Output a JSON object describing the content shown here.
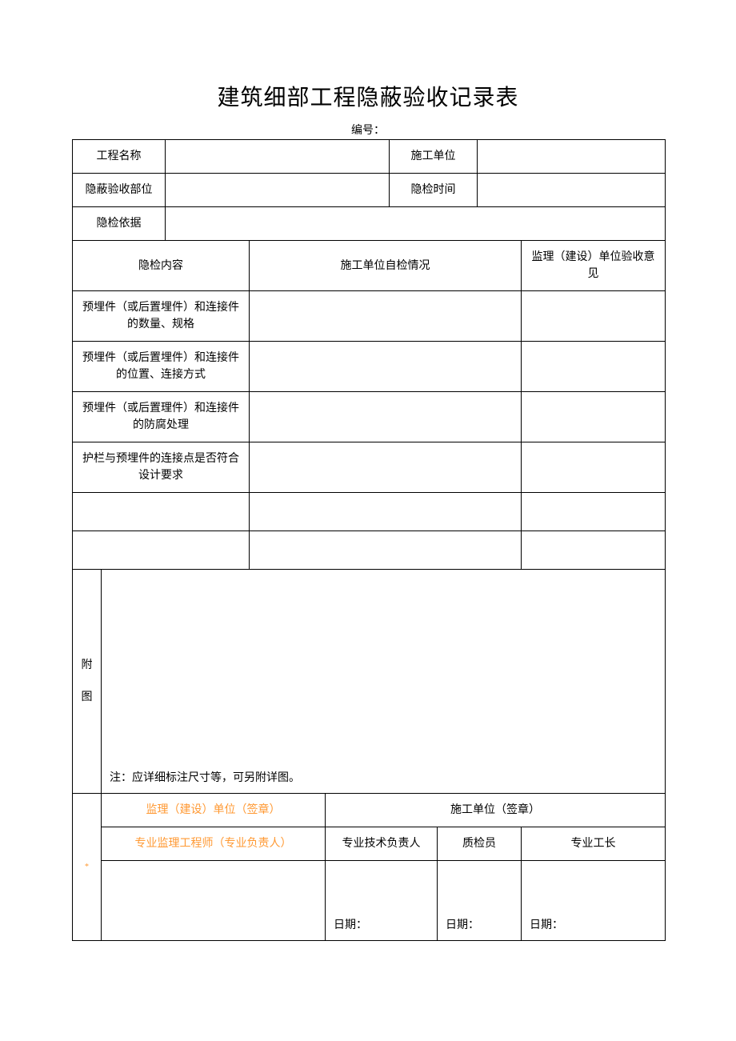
{
  "title": "建筑细部工程隐蔽验收记录表",
  "form_number_label": "编号：",
  "header": {
    "project_name_label": "工程名称",
    "project_name_value": "",
    "construction_unit_label": "施工单位",
    "construction_unit_value": "",
    "inspection_part_label": "隐蔽验收部位",
    "inspection_part_value": "",
    "inspection_time_label": "隐检时间",
    "inspection_time_value": "",
    "inspection_basis_label": "隐检依据",
    "inspection_basis_value": ""
  },
  "columns": {
    "content": "隐检内容",
    "self_check": "施工单位自检情况",
    "supervisor_opinion": "监理（建设）单位验收意见"
  },
  "rows": [
    {
      "content": "预埋件（或后置埋件）和连接件的数量、规格",
      "self_check": "",
      "opinion": ""
    },
    {
      "content": "预埋件（或后置埋件）和连接件的位置、连接方式",
      "self_check": "",
      "opinion": ""
    },
    {
      "content": "预埋件（或后置理件）和连接件的防腐处理",
      "self_check": "",
      "opinion": ""
    },
    {
      "content": "护栏与预埋件的连接点是否符合设计要求",
      "self_check": "",
      "opinion": ""
    },
    {
      "content": "",
      "self_check": "",
      "opinion": ""
    },
    {
      "content": "",
      "self_check": "",
      "opinion": ""
    }
  ],
  "attachment": {
    "label_char1": "附",
    "label_char2": "图",
    "note": "注：应详细标注尺寸等，可另附详图。"
  },
  "signature": {
    "side_label": "*",
    "supervisor_unit": "监理（建设）单位（签章）",
    "construction_unit": "施工单位（签章）",
    "supervisor_engineer": "专业监理工程师（专业负责人）",
    "tech_lead": "专业技术负责人",
    "qc": "质检员",
    "foreman": "专业工长",
    "date_label": "日期："
  }
}
